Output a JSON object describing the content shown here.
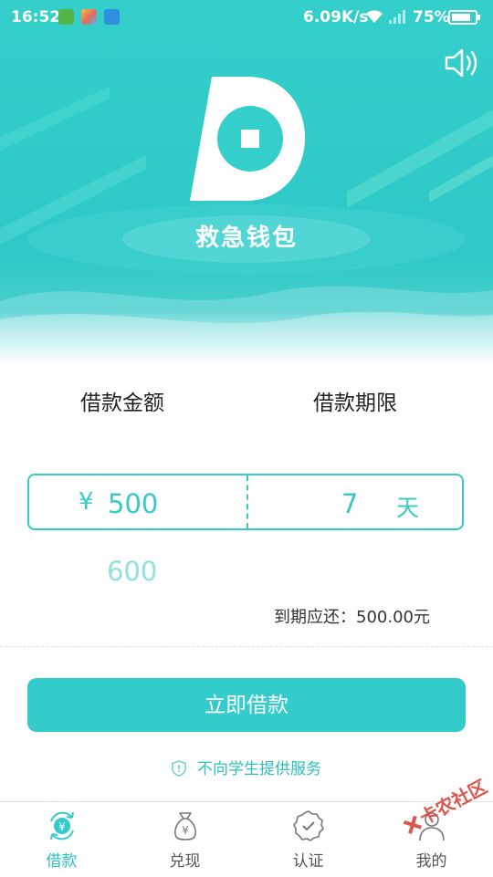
{
  "status_bar": {
    "time": "16:52",
    "network_speed": "6.09K/s",
    "battery": "75%"
  },
  "app": {
    "name": "救急钱包"
  },
  "loan": {
    "amount_label": "借款金额",
    "term_label": "借款期限",
    "currency_symbol": "¥",
    "selected_amount": "500",
    "next_amount": "600",
    "selected_days": "7",
    "days_unit": "天",
    "due_text": "到期应还：500.00元",
    "submit_label": "立即借款",
    "notice": "不向学生提供服务"
  },
  "tabs": [
    {
      "label": "借款",
      "icon": "loan-icon",
      "active": true
    },
    {
      "label": "兑现",
      "icon": "money-bag-icon",
      "active": false
    },
    {
      "label": "认证",
      "icon": "verify-badge-icon",
      "active": false
    },
    {
      "label": "我的",
      "icon": "user-icon",
      "active": false
    }
  ],
  "watermark": "卡农社区",
  "colors": {
    "accent": "#34cccb",
    "accent_light": "#8fe0de",
    "watermark": "#d9463a"
  }
}
